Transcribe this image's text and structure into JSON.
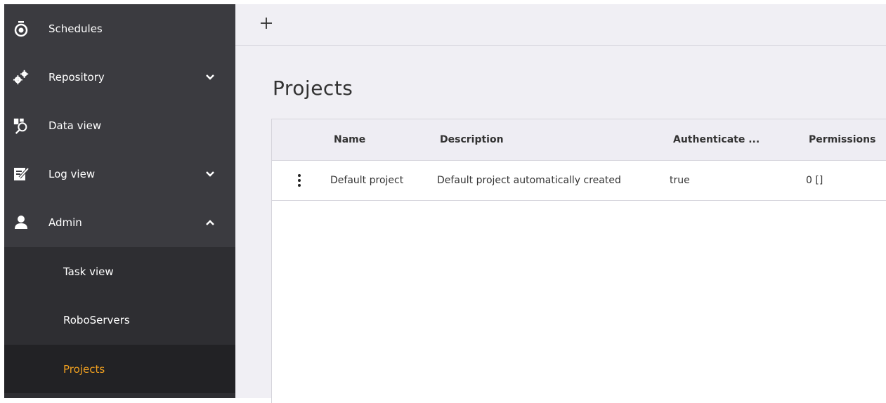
{
  "sidebar": {
    "items": [
      {
        "label": "Schedules",
        "icon": "stopwatch-icon"
      },
      {
        "label": "Repository",
        "icon": "gears-icon",
        "chevron": "down"
      },
      {
        "label": "Data view",
        "icon": "data-search-icon"
      },
      {
        "label": "Log view",
        "icon": "edit-log-icon",
        "chevron": "down"
      },
      {
        "label": "Admin",
        "icon": "user-icon",
        "chevron": "up"
      }
    ],
    "admin_subitems": [
      {
        "label": "Task view"
      },
      {
        "label": "RoboServers"
      },
      {
        "label": "Projects",
        "active": true
      }
    ]
  },
  "toolbar": {
    "add_icon": "plus-icon"
  },
  "main": {
    "title": "Projects",
    "table": {
      "columns": [
        "Name",
        "Description",
        "Authenticate ...",
        "Permissions"
      ],
      "rows": [
        {
          "name": "Default project",
          "description": "Default project automatically created",
          "authenticate": "true",
          "permissions": "0 []"
        }
      ]
    }
  },
  "colors": {
    "sidebar_bg": "#3b3b40",
    "subnav_bg": "#2e2e32",
    "active_bg": "#222225",
    "active_text": "#f0a020",
    "main_bg": "#f0eff4"
  }
}
